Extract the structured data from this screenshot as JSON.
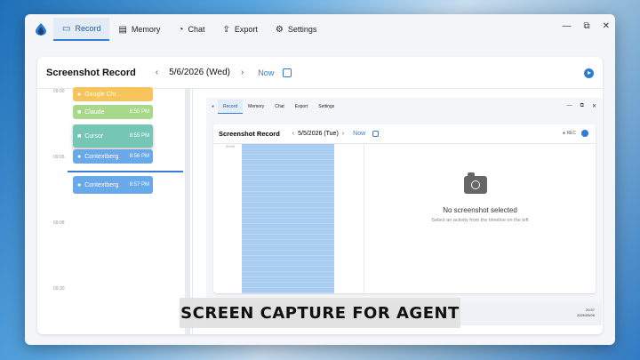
{
  "tabs": [
    {
      "label": "Record",
      "icon": "video-icon"
    },
    {
      "label": "Memory",
      "icon": "document-icon"
    },
    {
      "label": "Chat",
      "icon": "chat-icon"
    },
    {
      "label": "Export",
      "icon": "export-icon"
    },
    {
      "label": "Settings",
      "icon": "gear-icon"
    }
  ],
  "window_controls": {
    "minimize": "—",
    "restore": "⧉",
    "close": "✕"
  },
  "header": {
    "title": "Screenshot Record",
    "prev": "‹",
    "date": "5/6/2026 (Wed)",
    "next": "›",
    "now": "Now"
  },
  "timeline": {
    "times": [
      "09:00",
      "09:05",
      "09:08",
      "09:30"
    ],
    "cards": [
      {
        "label": "Google Chr...",
        "time": "",
        "color": "#f6c45a"
      },
      {
        "label": "Claude",
        "time": "8:55 PM",
        "color": "#a8d88a"
      },
      {
        "label": "Cursor",
        "time": "8:55 PM",
        "color": "#76c6b6"
      },
      {
        "label": "Contextberg",
        "time": "8:56 PM",
        "color": "#69a9ea"
      },
      {
        "label": "Contextberg",
        "time": "8:57 PM",
        "color": "#69a9ea"
      }
    ]
  },
  "nested": {
    "tabs": [
      "Record",
      "Memory",
      "Chat",
      "Export",
      "Settings"
    ],
    "title": "Screenshot Record",
    "date": "5/5/2026 (Tue)",
    "now": "Now",
    "rec": "● REC",
    "time": "09:00",
    "empty_title": "No screenshot selected",
    "empty_sub": "Select an activity from the timeline on the left",
    "clock": "20:57",
    "clock_date": "2026/05/06"
  },
  "overlay": {
    "caption": "SCREEN CAPTURE FOR AGENT"
  },
  "colors": {
    "accent": "#2f7bd3",
    "window": "#f3f5f8"
  }
}
